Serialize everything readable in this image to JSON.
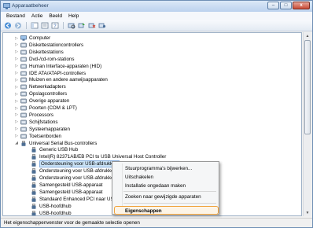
{
  "window": {
    "title": "Apparaatbeheer",
    "minimize_glyph": "–",
    "maximize_glyph": "□",
    "close_glyph": "x"
  },
  "menubar": {
    "items": [
      "Bestand",
      "Actie",
      "Beeld",
      "Help"
    ]
  },
  "toolbar": {
    "icons": [
      "back-arrow-icon",
      "forward-arrow-icon",
      "show-hide-tree-icon",
      "properties-icon",
      "help-icon",
      "scan-hardware-icon",
      "update-driver-icon",
      "uninstall-icon",
      "disable-icon"
    ]
  },
  "tree": {
    "nodes": [
      {
        "label": "Computer",
        "expander": "▷",
        "icon": "computer-icon",
        "level": 1
      },
      {
        "label": "Diskettestationcontrollers",
        "expander": "▷",
        "icon": "floppy-controller-icon",
        "level": 1
      },
      {
        "label": "Diskettestations",
        "expander": "▷",
        "icon": "floppy-drive-icon",
        "level": 1
      },
      {
        "label": "Dvd-/cd-rom-stations",
        "expander": "▷",
        "icon": "dvd-drive-icon",
        "level": 1
      },
      {
        "label": "Human Interface-apparaten (HID)",
        "expander": "▷",
        "icon": "hid-icon",
        "level": 1
      },
      {
        "label": "IDE ATA/ATAPI-controllers",
        "expander": "▷",
        "icon": "ide-controller-icon",
        "level": 1
      },
      {
        "label": "Muizen en andere aanwijsapparaten",
        "expander": "▷",
        "icon": "mouse-icon",
        "level": 1
      },
      {
        "label": "Netwerkadapters",
        "expander": "▷",
        "icon": "network-adapter-icon",
        "level": 1
      },
      {
        "label": "Opslagcontrollers",
        "expander": "▷",
        "icon": "storage-controller-icon",
        "level": 1
      },
      {
        "label": "Overige apparaten",
        "expander": "▷",
        "icon": "other-devices-icon",
        "level": 1
      },
      {
        "label": "Poorten (COM & LPT)",
        "expander": "▷",
        "icon": "port-icon",
        "level": 1
      },
      {
        "label": "Processors",
        "expander": "▷",
        "icon": "processor-icon",
        "level": 1
      },
      {
        "label": "Schijfstations",
        "expander": "▷",
        "icon": "disk-drive-icon",
        "level": 1
      },
      {
        "label": "Systeemapparaten",
        "expander": "▷",
        "icon": "system-devices-icon",
        "level": 1
      },
      {
        "label": "Toetsenborden",
        "expander": "▷",
        "icon": "keyboard-icon",
        "level": 1
      },
      {
        "label": "Universal Serial Bus-controllers",
        "expander": "◢",
        "icon": "usb-controller-icon",
        "level": 1
      },
      {
        "label": "Generic USB Hub",
        "expander": "",
        "icon": "usb-device-icon",
        "level": 2
      },
      {
        "label": "Intel(R) 82371AB/EB PCI to USB Universal Host Controller",
        "expander": "",
        "icon": "usb-device-icon",
        "level": 2
      },
      {
        "label": "Ondersteuning voor USB-afdrukken",
        "expander": "",
        "icon": "usb-device-icon",
        "level": 2,
        "selected": true
      },
      {
        "label": "Ondersteuning voor USB-afdrukken",
        "expander": "",
        "icon": "usb-device-icon",
        "level": 2
      },
      {
        "label": "Ondersteuning voor USB-afdrukken",
        "expander": "",
        "icon": "usb-device-icon",
        "level": 2
      },
      {
        "label": "Samengesteld USB-apparaat",
        "expander": "",
        "icon": "usb-device-icon",
        "level": 2
      },
      {
        "label": "Samengesteld USB-apparaat",
        "expander": "",
        "icon": "usb-device-icon",
        "level": 2
      },
      {
        "label": "Standaard Enhanced PCI naar USB-H",
        "expander": "",
        "icon": "usb-device-icon",
        "level": 2
      },
      {
        "label": "USB-hoofdhub",
        "expander": "",
        "icon": "usb-device-icon",
        "level": 2
      },
      {
        "label": "USB-hoofdhub",
        "expander": "",
        "icon": "usb-device-icon",
        "level": 2
      }
    ]
  },
  "context_menu": {
    "items": [
      {
        "label": "Stuurprogramma's bijwerken..."
      },
      {
        "label": "Uitschakelen"
      },
      {
        "label": "Installatie ongedaan maken"
      },
      {
        "label": "Zoeken naar gewijzigde apparaten"
      },
      {
        "label": "Eigenschappen",
        "bold": true,
        "highlighted": true
      }
    ]
  },
  "statusbar": {
    "text": "Het eigenschappenvenster voor de gemaakte selectie openen"
  },
  "colors": {
    "highlight_border": "#f0a23a",
    "selection_fill": "#cce4f7",
    "title_text": "#1e395b"
  }
}
